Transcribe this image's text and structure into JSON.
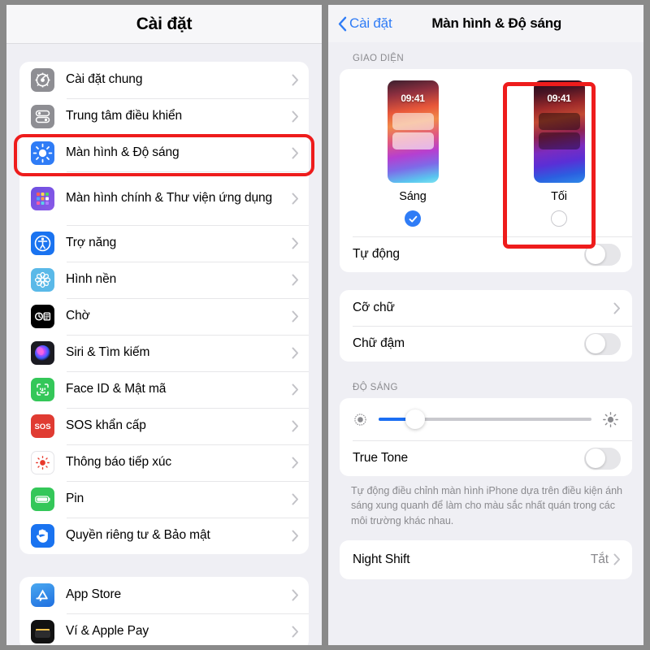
{
  "left_panel": {
    "nav_title": "Cài đặt",
    "groups": [
      {
        "items": [
          {
            "label": "Cài đặt chung",
            "icon": "gear-icon"
          },
          {
            "label": "Trung tâm điều khiển",
            "icon": "control-center-icon"
          },
          {
            "label": "Màn hình & Độ sáng",
            "icon": "display-brightness-icon",
            "highlighted": true
          },
          {
            "label": "Màn hình chính & Thư viện ứng dụng",
            "icon": "home-screen-icon"
          },
          {
            "label": "Trợ năng",
            "icon": "accessibility-icon"
          },
          {
            "label": "Hình nền",
            "icon": "wallpaper-icon"
          },
          {
            "label": "Chờ",
            "icon": "standby-icon"
          },
          {
            "label": "Siri & Tìm kiếm",
            "icon": "siri-icon"
          },
          {
            "label": "Face ID & Mật mã",
            "icon": "faceid-icon"
          },
          {
            "label": "SOS khẩn cấp",
            "icon": "sos-icon"
          },
          {
            "label": "Thông báo tiếp xúc",
            "icon": "exposure-notification-icon"
          },
          {
            "label": "Pin",
            "icon": "battery-icon"
          },
          {
            "label": "Quyền riêng tư & Bảo mật",
            "icon": "privacy-hand-icon"
          }
        ]
      },
      {
        "items": [
          {
            "label": "App Store",
            "icon": "app-store-icon"
          },
          {
            "label": "Ví & Apple Pay",
            "icon": "wallet-icon"
          }
        ]
      }
    ]
  },
  "right_panel": {
    "back_label": "Cài đặt",
    "nav_title": "Màn hình & Độ sáng",
    "appearance": {
      "section_header": "GIAO DIỆN",
      "options": [
        {
          "name": "Sáng",
          "selected": true,
          "time": "09:41"
        },
        {
          "name": "Tối",
          "selected": false,
          "time": "09:41",
          "highlighted": true
        }
      ],
      "auto_row": {
        "label": "Tự động",
        "toggle_on": false
      }
    },
    "text": {
      "rows": [
        {
          "label": "Cỡ chữ",
          "type": "chevron"
        },
        {
          "label": "Chữ đậm",
          "type": "toggle",
          "toggle_on": false
        }
      ]
    },
    "brightness": {
      "section_header": "ĐỘ SÁNG",
      "slider_percent": 17,
      "low_icon": "brightness-low-icon",
      "high_icon": "brightness-high-icon",
      "true_tone": {
        "label": "True Tone",
        "toggle_on": false
      },
      "footnote": "Tự động điều chỉnh màn hình iPhone dựa trên điều kiện ánh sáng xung quanh để làm cho màu sắc nhất quán trong các môi trường khác nhau."
    },
    "night_shift": {
      "label": "Night Shift",
      "value": "Tắt"
    }
  },
  "colors": {
    "accent_blue": "#2f7cf6",
    "highlight_red": "#ee1c1c",
    "slider_blue": "#1b6ef3",
    "page_bg": "#efeff4"
  }
}
